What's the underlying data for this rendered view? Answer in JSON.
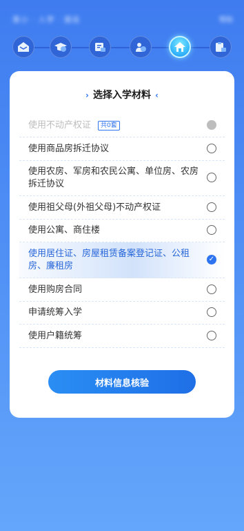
{
  "header": {
    "title": "某小 · 入学 · 报名",
    "right_text": "帮助"
  },
  "steps": [
    {
      "icon": "home-mail-icon",
      "active": false
    },
    {
      "icon": "graduation-cap-icon",
      "active": false
    },
    {
      "icon": "id-card-icon",
      "active": false
    },
    {
      "icon": "parent-child-icon",
      "active": false
    },
    {
      "icon": "house-icon",
      "active": true
    },
    {
      "icon": "clipboard-icon",
      "active": false
    }
  ],
  "card": {
    "title": "选择入学材料",
    "deco_left": "›",
    "deco_right": "‹",
    "items": [
      {
        "label": "使用不动产权证",
        "badge": "共0套",
        "state": "disabled"
      },
      {
        "label": "使用商品房拆迁协议",
        "state": "unchecked"
      },
      {
        "label": "使用农房、军房和农民公寓、单位房、农房拆迁协议",
        "state": "unchecked"
      },
      {
        "label": "使用祖父母(外祖父母)不动产权证",
        "state": "unchecked"
      },
      {
        "label": "使用公寓、商住楼",
        "state": "unchecked"
      },
      {
        "label": "使用居住证、房屋租赁备案登记证、公租房、廉租房",
        "state": "checked"
      },
      {
        "label": "使用购房合同",
        "state": "unchecked"
      },
      {
        "label": "申请统筹入学",
        "state": "unchecked"
      },
      {
        "label": "使用户籍统筹",
        "state": "unchecked"
      }
    ],
    "submit_label": "材料信息核验"
  },
  "colors": {
    "accent": "#2e74f0",
    "background_top": "#3f7cf0",
    "background_bottom": "#64a6fb",
    "selected_text": "#2766d9",
    "disabled": "#bdbdbd"
  }
}
